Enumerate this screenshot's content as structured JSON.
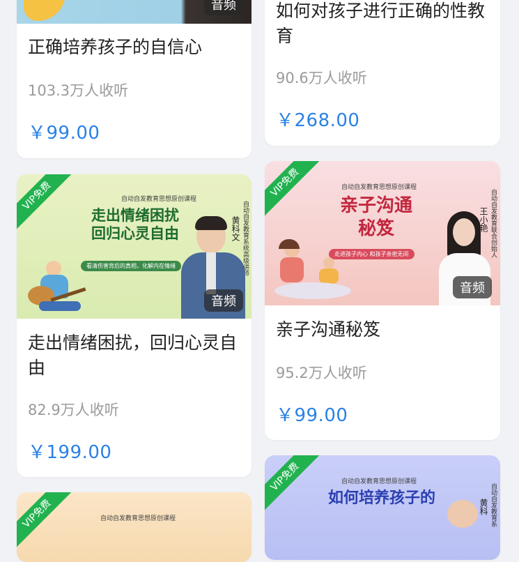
{
  "cards": [
    {
      "title": "正确培养孩子的自信心",
      "listeners": "103.3万人收听",
      "price": "￥99.00",
      "badge": "音频"
    },
    {
      "title": "如何对孩子进行正确的性教育",
      "listeners": "90.6万人收听",
      "price": "￥268.00"
    },
    {
      "title": "走出情绪困扰，回归心灵自由",
      "listeners": "82.9万人收听",
      "price": "￥199.00",
      "badge": "音频",
      "vip": "VIP免费",
      "cover": {
        "top": "自动自发教育思想原创课程",
        "head1": "走出情绪困扰",
        "head2": "回归心灵自由",
        "sub": "看清伤害背后的真相，化解内在情绪",
        "side": "自动自发教育系统高级讲师",
        "name": "黄科文"
      }
    },
    {
      "title": "亲子沟通秘笈",
      "listeners": "95.2万人收听",
      "price": "￥99.00",
      "badge": "音频",
      "vip": "VIP免费",
      "cover": {
        "top": "自动自发教育思想原创课程",
        "head1": "亲子沟通",
        "head2": "秘笈",
        "sub": "走进孩子内心  和孩子亲密无间",
        "side": "自动自发教育联合创始人",
        "name": "王小艳"
      }
    },
    {
      "vip": "VIP免费",
      "cover": {
        "top": "自动自发教育思想原创课程"
      }
    },
    {
      "vip": "VIP免费",
      "cover": {
        "top": "自动自发教育思想原创课程",
        "head1": "如何培养孩子的",
        "side": "自动自发教育系",
        "name": "黄科"
      }
    }
  ],
  "colors": {
    "price": "#2a82e4",
    "vip": "#21b24f",
    "background": "#f1f2f6"
  }
}
